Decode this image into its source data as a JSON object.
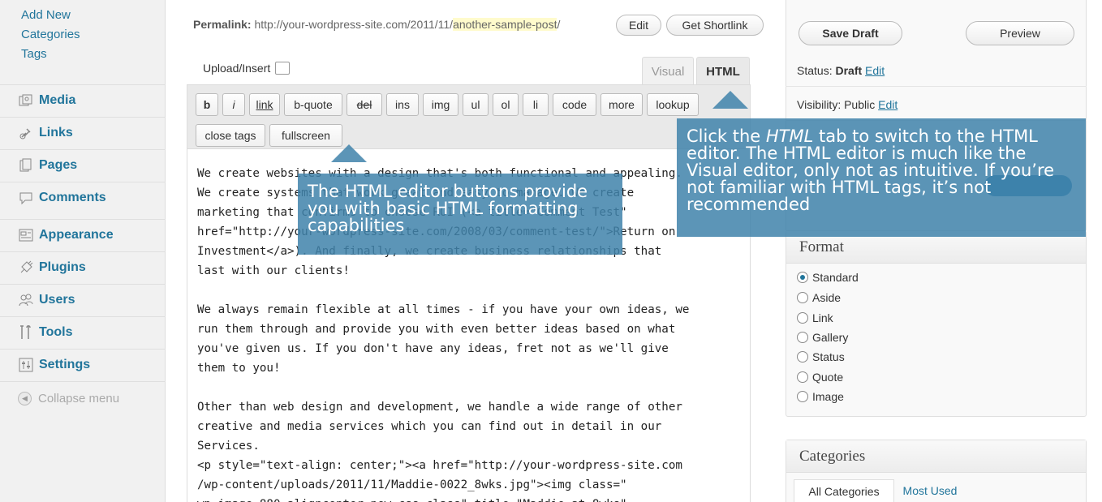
{
  "sidebar": {
    "posts_submenu": [
      "Add New",
      "Categories",
      "Tags"
    ],
    "items": [
      {
        "label": "Media",
        "icon": "media-icon"
      },
      {
        "label": "Links",
        "icon": "links-icon"
      },
      {
        "label": "Pages",
        "icon": "pages-icon"
      },
      {
        "label": "Comments",
        "icon": "comments-icon"
      },
      {
        "label": "Appearance",
        "icon": "appearance-icon"
      },
      {
        "label": "Plugins",
        "icon": "plugins-icon"
      },
      {
        "label": "Users",
        "icon": "users-icon"
      },
      {
        "label": "Tools",
        "icon": "tools-icon"
      },
      {
        "label": "Settings",
        "icon": "settings-icon"
      }
    ],
    "collapse_label": "Collapse menu"
  },
  "permalink": {
    "label": "Permalink:",
    "base": "http://your-wordpress-site.com/2011/11/",
    "slug": "another-sample-post",
    "trail": "/",
    "edit_label": "Edit",
    "shortlink_label": "Get Shortlink"
  },
  "editor": {
    "upload_label": "Upload/Insert",
    "tabs": {
      "visual": "Visual",
      "html": "HTML"
    },
    "quicktags": [
      "b",
      "i",
      "link",
      "b-quote",
      "del",
      "ins",
      "img",
      "ul",
      "ol",
      "li",
      "code",
      "more",
      "lookup",
      "close tags",
      "fullscreen"
    ],
    "paragraphs": [
      "We create websites with a design that's both functional and appealing.\nWe create systems that work great and easy to manage. We create\nmarketing that confirms to choose ROI (<a title=\"Comment Test\"\nhref=\"http://your-wordpress-site.com/2008/03/comment-test/\">Return on\nInvestment</a>). And finally, we create business relationships that\nlast with our clients!",
      "We always remain flexible at all times - if you have your own ideas, we\nrun them through and provide you with even better ideas based on what\nyou've given us. If you don't have any ideas, fret not as we'll give\nthem to you!",
      "Other than web design and development, we handle a wide range of other\ncreative and media services which you can find out in detail in our\nServices.\n<p style=\"text-align: center;\"><a href=\"http://your-wordpress-site.com\n/wp-content/uploads/2011/11/Maddie-0022_8wks.jpg\"><img class=\"\nwp-image-880 aligncenter new-css-class\" title=\"Maddie at 8wks\""
    ]
  },
  "publish": {
    "save_draft": "Save Draft",
    "preview": "Preview",
    "status_label": "Status:",
    "status_value": "Draft",
    "visibility_label": "Visibility: Public",
    "edit_link": "Edit"
  },
  "format": {
    "title": "Format",
    "options": [
      "Standard",
      "Aside",
      "Link",
      "Gallery",
      "Status",
      "Quote",
      "Image"
    ],
    "selected": "Standard"
  },
  "categories": {
    "title": "Categories",
    "tabs": [
      "All Categories",
      "Most Used"
    ]
  },
  "tooltips": {
    "buttons": "The HTML editor buttons provide you with basic HTML formatting capabilities",
    "tab_pre": "Click the ",
    "tab_em": "HTML",
    "tab_post": " tab to switch to the HTML editor. The HTML editor is much like the Visual editor, only not as intuitive. If you’re not familiar with HTML tags, it’s not recommended"
  },
  "colors": {
    "link": "#21759b",
    "tooltip": "#3f83aa"
  }
}
